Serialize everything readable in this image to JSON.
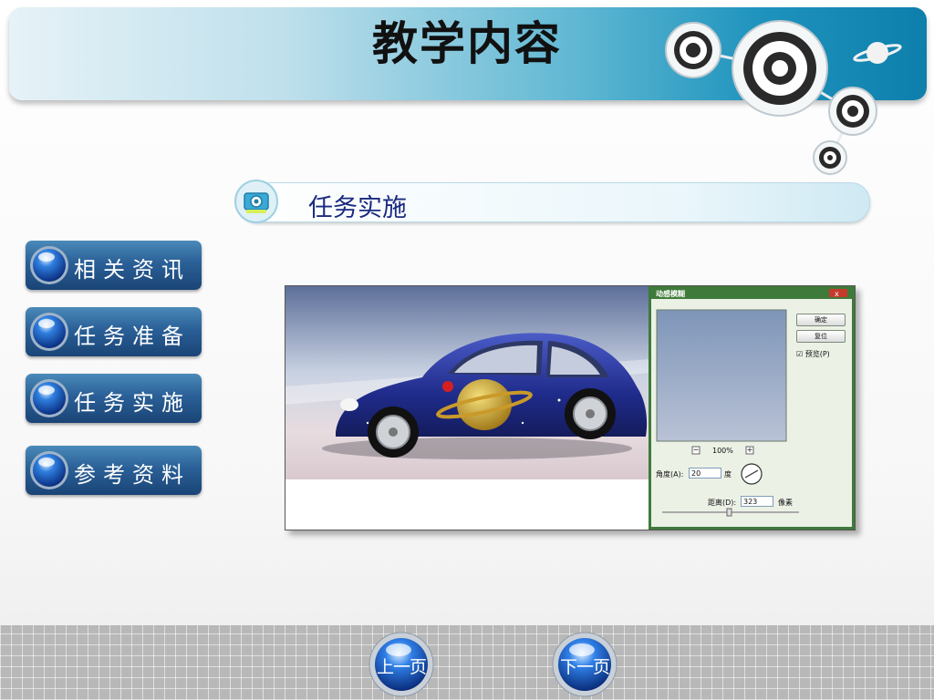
{
  "header": {
    "title": "教学内容"
  },
  "section": {
    "title": "任务实施"
  },
  "menu": {
    "items": [
      {
        "label": "相关资讯"
      },
      {
        "label": "任务准备"
      },
      {
        "label": "任务实施"
      },
      {
        "label": "参考资料"
      }
    ]
  },
  "screenshot": {
    "dialog": {
      "title": "动感模糊",
      "ok_label": "确定",
      "reset_label": "复位",
      "preview_label": "预览(P)",
      "zoom_out": "−",
      "zoom_level": "100%",
      "zoom_in": "+",
      "angle_label": "角度(A):",
      "angle_value": "20",
      "angle_unit": "度",
      "distance_label": "距离(D):",
      "distance_value": "323",
      "distance_unit": "像素"
    }
  },
  "nav": {
    "prev_label": "上一页",
    "next_label": "下一页"
  },
  "colors": {
    "menu_button": "#2a6097",
    "section_text": "#1a2a80",
    "dialog_frame": "#3e7a3a"
  }
}
